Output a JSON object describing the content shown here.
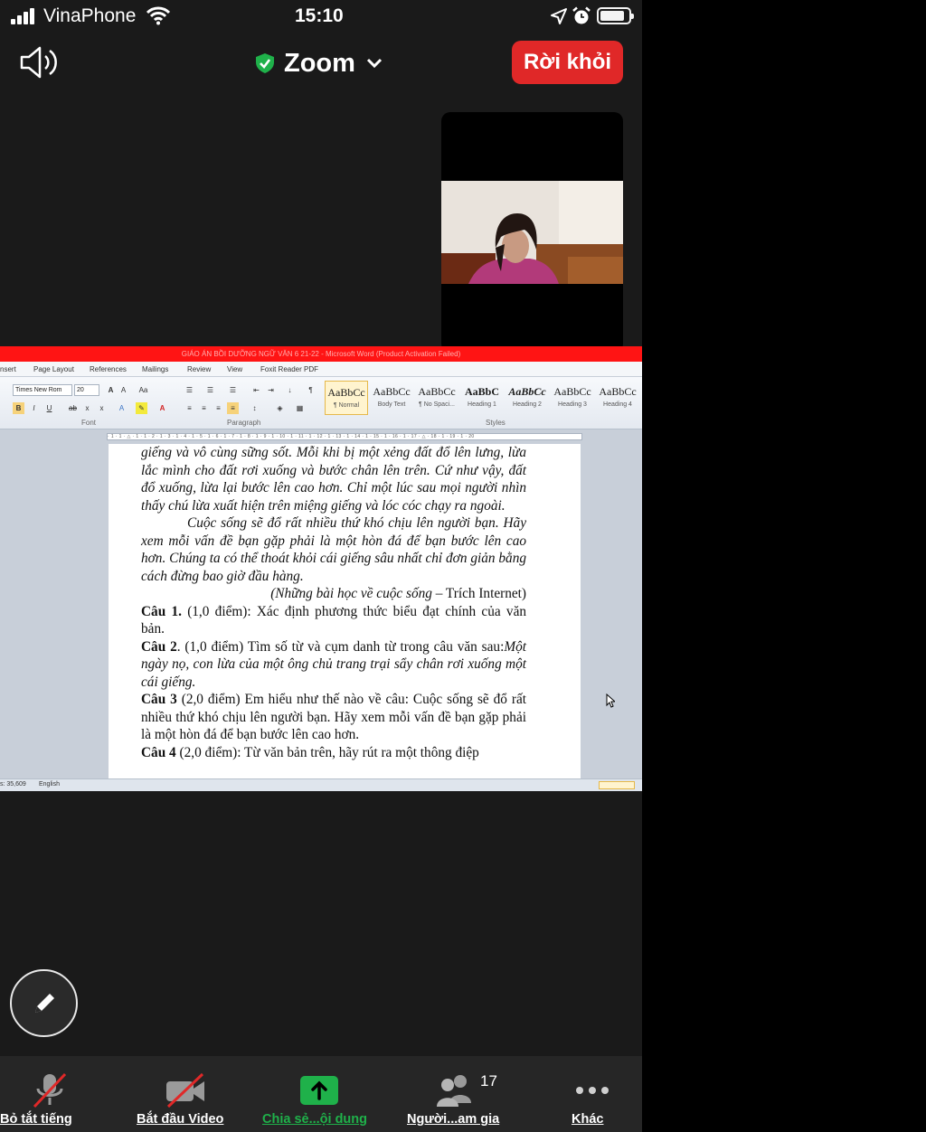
{
  "status_bar": {
    "carrier": "VinaPhone",
    "time": "15:10"
  },
  "top_bar": {
    "meeting_title": "Zoom",
    "leave_label": "Rời khỏi"
  },
  "word": {
    "title": "GIÁO ÁN BỒI DƯỠNG NGỮ VĂN 6 21-22 - Microsoft Word (Product Activation Failed)",
    "menu": [
      "nsert",
      "Page Layout",
      "References",
      "Mailings",
      "Review",
      "View",
      "Foxit Reader PDF"
    ],
    "font_name": "Times New Rom",
    "font_size": "20",
    "groups": {
      "font": "Font",
      "paragraph": "Paragraph",
      "styles": "Styles"
    },
    "styles": [
      {
        "sample": "AaBbCc",
        "name": "¶ Normal"
      },
      {
        "sample": "AaBbCc",
        "name": "Body Text"
      },
      {
        "sample": "AaBbCc",
        "name": "¶ No Spaci..."
      },
      {
        "sample": "AaBbC",
        "name": "Heading 1"
      },
      {
        "sample": "AaBbCc",
        "name": "Heading 2"
      },
      {
        "sample": "AaBbCc",
        "name": "Heading 3"
      },
      {
        "sample": "AaBbCc",
        "name": "Heading 4"
      }
    ],
    "ruler": "· 1 · 1 · △ · 1 · 1 · 2 · 1 · 3 · 1 · 4 · 1 · 5 · 1 · 6 · 1 · 7 · 1 · 8 · 1 · 9 · 1 · 10 · 1 · 11 · 1 · 12 · 1 · 13 · 1 · 14 · 1 · 15 · 1 · 16 · 1 · 17 · △ · 18 · 1 · 19 · 1 · 20",
    "doc": {
      "p1": "giếng và vô cùng sững sốt. Mỗi khi bị một xẻng đất đổ lên lưng, lừa lắc mình cho đất rơi xuống và bước chân lên trên. Cứ như vậy, đất đổ xuống, lừa lại bước lên cao hơn. Chỉ một lúc sau mọi người nhìn thấy chú lừa xuất hiện trên miệng giếng và lóc cóc chạy ra ngoài.",
      "p2": "Cuộc sống sẽ đổ rất nhiều thứ khó chịu lên người bạn. Hãy xem mỗi vấn đề bạn gặp phải là một hòn đá để bạn bước lên cao hơn. Chúng ta có thể thoát khỏi cái giếng sâu nhất chỉ đơn giản bằng cách đừng bao giờ đầu hàng.",
      "source_title": "(Những bài học về cuộc sống",
      "source_rest": " – Trích Internet)",
      "q1_label": "Câu 1.",
      "q1_text": " (1,0 điểm): Xác định phương thức biểu đạt chính của văn bản.",
      "q2_label": "Câu 2",
      "q2_text": ". (1,0 điểm) Tìm số từ và cụm danh từ trong câu văn sau:",
      "q2_quote": "Một ngày nọ, con lừa của một ông chủ trang trại sẩy chân rơi xuống một cái giếng.",
      "q3_label": "Câu 3",
      "q3_text": " (2,0 điểm) Em hiểu như thế nào về câu:  Cuộc sống sẽ đổ rất nhiều thứ khó chịu lên người bạn. Hãy xem mỗi vấn đề bạn gặp phải là một hòn đá để bạn bước lên cao hơn.",
      "q4_label": "Câu 4",
      "q4_text": " (2,0 điểm): Từ văn bản trên, hãy rút ra một thông điệp"
    },
    "status": {
      "words": "s: 35,609",
      "language": "English"
    }
  },
  "toolbar": {
    "mute_all": "Bỏ tắt tiếng",
    "start_video": "Bắt đầu Video",
    "share_content": "Chia sẻ...ội dung",
    "participants": "Người...am gia",
    "participant_count": "17",
    "more": "Khác"
  },
  "colors": {
    "leave": "#e02828",
    "share_green": "#1fb14a",
    "word_title": "#ff1414"
  }
}
